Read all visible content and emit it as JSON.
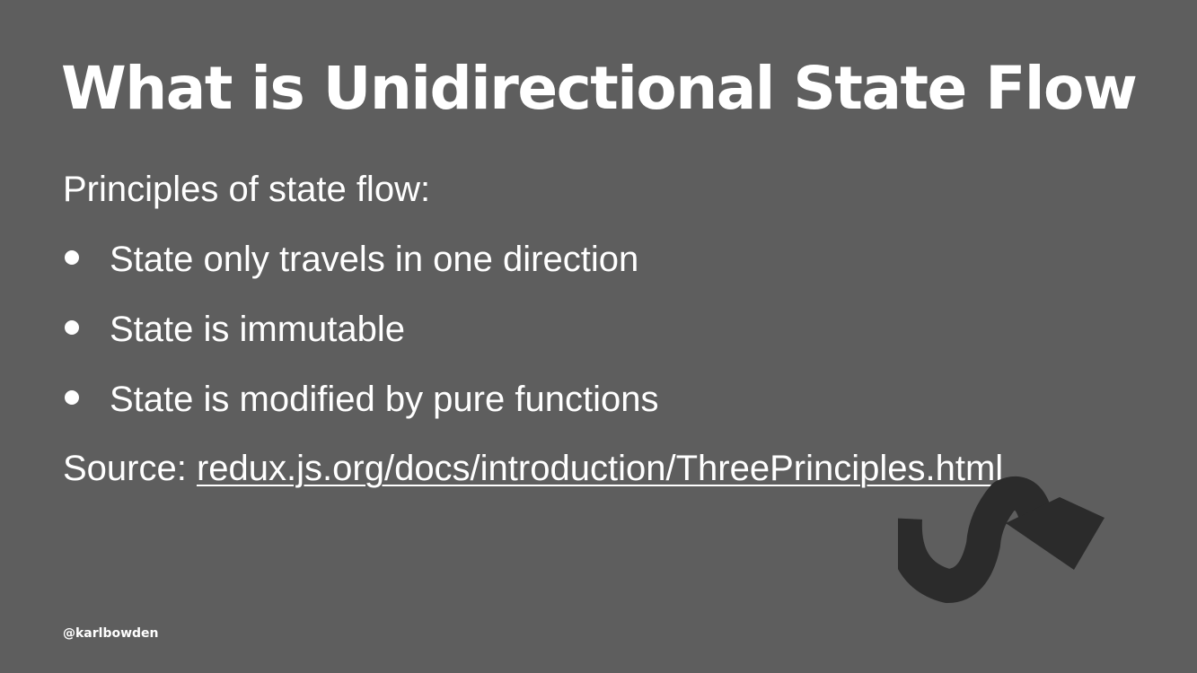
{
  "slide": {
    "title": "What is Unidirectional State Flow",
    "intro": "Principles of state flow:",
    "bullets": [
      {
        "text": "State only travels in one direction"
      },
      {
        "text": "State is immutable"
      },
      {
        "text": "State is modified by pure functions"
      }
    ],
    "source": {
      "label": "Source: ",
      "link_text": "redux.js.org/docs/introduction/ThreePrinciples.html"
    },
    "footer_handle": "@karlbowden",
    "logo_icon": "unidirectional-flow-arrow-icon"
  },
  "colors": {
    "background": "#5e5e5e",
    "text": "#ffffff",
    "logo": "#2b2b2b"
  }
}
